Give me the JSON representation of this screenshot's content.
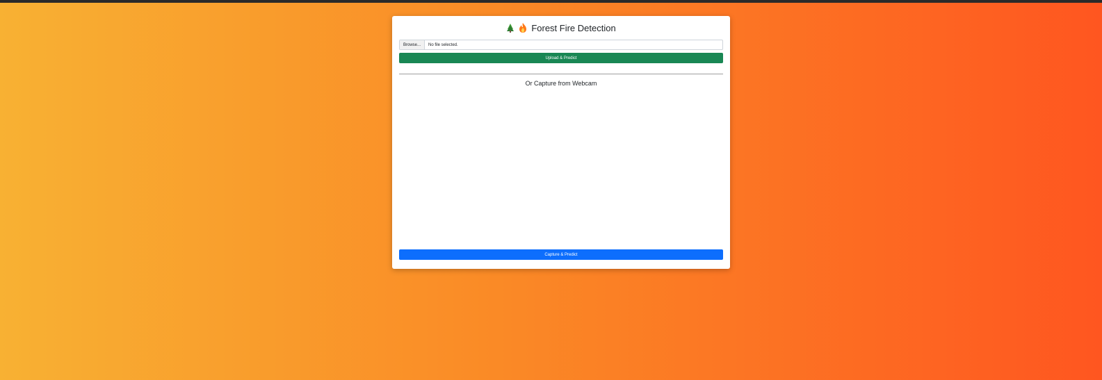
{
  "header": {
    "title": "Forest Fire Detection",
    "icons": [
      "tree-icon",
      "fire-icon"
    ]
  },
  "upload": {
    "browse_label": "Browse...",
    "file_status": "No file selected.",
    "submit_label": "Upload & Predict"
  },
  "webcam": {
    "heading": "Or Capture from Webcam",
    "capture_label": "Capture & Predict"
  },
  "colors": {
    "background_start": "#f8b133",
    "background_end": "#ff5620",
    "upload_button": "#198754",
    "capture_button": "#0d6efd"
  }
}
